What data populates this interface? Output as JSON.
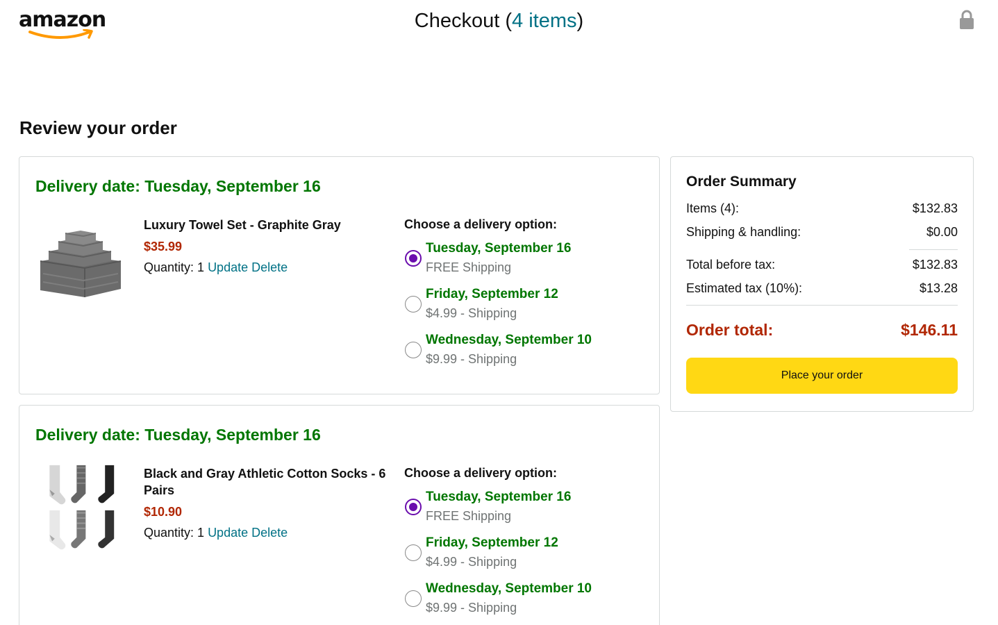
{
  "header": {
    "logo_text": "amazon",
    "title_prefix": "Checkout (",
    "item_count": "4 items",
    "title_suffix": ")",
    "lock_icon": "lock-icon"
  },
  "review_title": "Review your order",
  "orders": [
    {
      "delivery_date": "Delivery date: Tuesday, September 16",
      "product_name": "Luxury Towel Set - Graphite Gray",
      "price": "$35.99",
      "quantity": "Quantity: 1",
      "update_label": "Update",
      "delete_label": "Delete",
      "options_title": "Choose a delivery option:",
      "options": [
        {
          "date": "Tuesday, September 16",
          "shipping": "FREE Shipping",
          "selected": true
        },
        {
          "date": "Friday, September 12",
          "shipping": "$4.99 - Shipping",
          "selected": false
        },
        {
          "date": "Wednesday, September 10",
          "shipping": "$9.99 - Shipping",
          "selected": false
        }
      ]
    },
    {
      "delivery_date": "Delivery date: Tuesday, September 16",
      "product_name": "Black and Gray Athletic Cotton Socks - 6 Pairs",
      "price": "$10.90",
      "quantity": "Quantity: 1",
      "update_label": "Update",
      "delete_label": "Delete",
      "options_title": "Choose a delivery option:",
      "options": [
        {
          "date": "Tuesday, September 16",
          "shipping": "FREE Shipping",
          "selected": true
        },
        {
          "date": "Friday, September 12",
          "shipping": "$4.99 - Shipping",
          "selected": false
        },
        {
          "date": "Wednesday, September 10",
          "shipping": "$9.99 - Shipping",
          "selected": false
        }
      ]
    }
  ],
  "summary": {
    "title": "Order Summary",
    "items_label": "Items (4):",
    "items_value": "$132.83",
    "shipping_label": "Shipping & handling:",
    "shipping_value": "$0.00",
    "before_tax_label": "Total before tax:",
    "before_tax_value": "$132.83",
    "tax_label": "Estimated tax (10%):",
    "tax_value": "$13.28",
    "total_label": "Order total:",
    "total_value": "$146.11",
    "place_order_label": "Place your order"
  },
  "colors": {
    "link": "#007185",
    "delivery_green": "#007600",
    "price_red": "#b12704",
    "button_yellow": "#ffd814",
    "radio_purple": "#6a0dad"
  }
}
